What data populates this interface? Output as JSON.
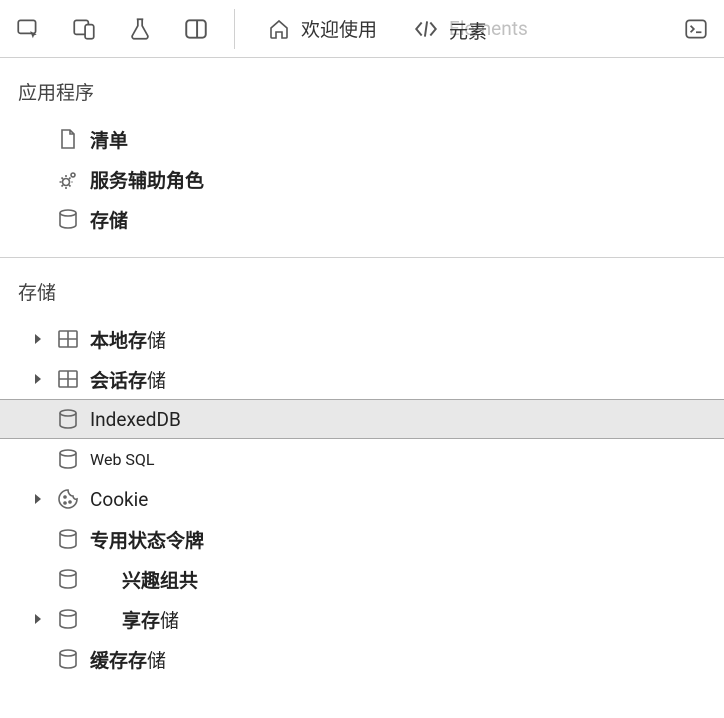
{
  "toolbar": {
    "tabs": {
      "welcome": "欢迎使用",
      "elements": "元素",
      "elements_ghost": "Elements"
    }
  },
  "section_application": {
    "title": "应用程序",
    "items": {
      "manifest": "清单",
      "service_workers": "服务辅助角色",
      "storage": "存储"
    }
  },
  "section_storage": {
    "title": "存储",
    "items": {
      "local_storage_bold": "本地存",
      "local_storage_tail": "储",
      "session_storage_bold": "会话存",
      "session_storage_tail": "储",
      "indexed_db": "IndexedDB",
      "web_sql": "Web SQL",
      "cookie": "Cookie",
      "private_token_bold": "专用状态令牌",
      "interest_group_bold": "兴趣组共",
      "shared_bold": "享存",
      "shared_tail": "储",
      "cache_bold": "缓存存",
      "cache_tail": "储"
    }
  }
}
